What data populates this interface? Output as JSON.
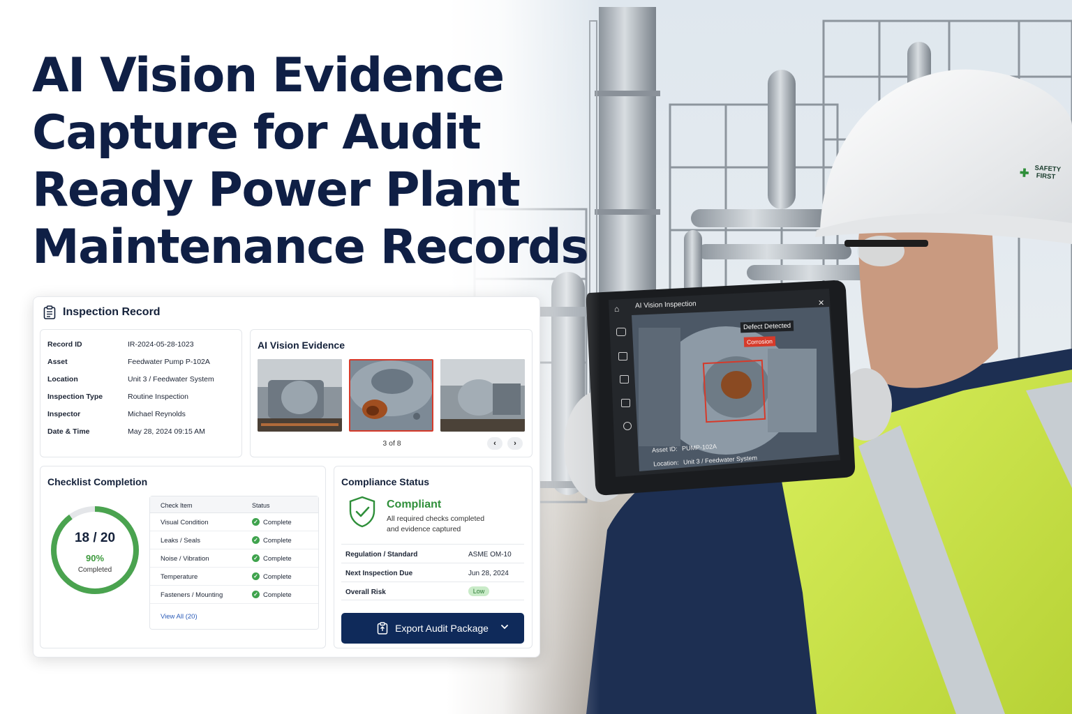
{
  "headline": {
    "lines": [
      "AI Vision Evidence",
      "Capture for Audit",
      "Ready Power Plant",
      "Maintenance Records"
    ]
  },
  "record_card": {
    "title": "Inspection Record",
    "fields": [
      {
        "label": "Record ID",
        "value": "IR-2024-05-28-1023"
      },
      {
        "label": "Asset",
        "value": "Feedwater Pump P-102A"
      },
      {
        "label": "Location",
        "value": "Unit 3 / Feedwater System"
      },
      {
        "label": "Inspection Type",
        "value": "Routine Inspection"
      },
      {
        "label": "Inspector",
        "value": "Michael Reynolds"
      },
      {
        "label": "Date & Time",
        "value": "May 28, 2024 09:15 AM"
      }
    ]
  },
  "vision_evidence": {
    "title": "AI Vision Evidence",
    "counter": "3 of 8",
    "selected_index": 1,
    "prev_icon": "chevron-left-icon",
    "next_icon": "chevron-right-icon"
  },
  "checklist": {
    "title": "Checklist Completion",
    "completed_text": "18 / 20",
    "percent_text": "90%",
    "completed_label": "Completed",
    "progress_fraction": 0.9,
    "headers": {
      "item": "Check Item",
      "status": "Status"
    },
    "rows": [
      {
        "item": "Visual Condition",
        "status": "Complete"
      },
      {
        "item": "Leaks / Seals",
        "status": "Complete"
      },
      {
        "item": "Noise / Vibration",
        "status": "Complete"
      },
      {
        "item": "Temperature",
        "status": "Complete"
      },
      {
        "item": "Fasteners / Mounting",
        "status": "Complete"
      }
    ],
    "view_all": "View All (20)"
  },
  "compliance": {
    "title": "Compliance Status",
    "status": "Compliant",
    "desc_line1": "All required checks completed",
    "desc_line2": "and evidence captured",
    "rows": [
      {
        "label": "Regulation / Standard",
        "value": "ASME OM-10"
      },
      {
        "label": "Next Inspection Due",
        "value": "Jun 28, 2024"
      },
      {
        "label": "Overall Risk",
        "value": "Low"
      }
    ],
    "export_label": "Export Audit Package"
  },
  "tablet": {
    "title": "AI Vision Inspection",
    "defect_label": "Defect Detected",
    "defect_type": "Corrosion",
    "asset_label": "Asset ID:",
    "asset_value": "PUMP-102A",
    "location_label": "Location:",
    "location_value": "Unit 3 / Feedwater System"
  },
  "helmet": {
    "line1": "SAFETY",
    "line2": "FIRST"
  },
  "colors": {
    "navy": "#0f1f45",
    "button": "#0f2a5a",
    "success": "#3fa34d",
    "alert": "#d63a2a",
    "vest": "#cde84a"
  }
}
